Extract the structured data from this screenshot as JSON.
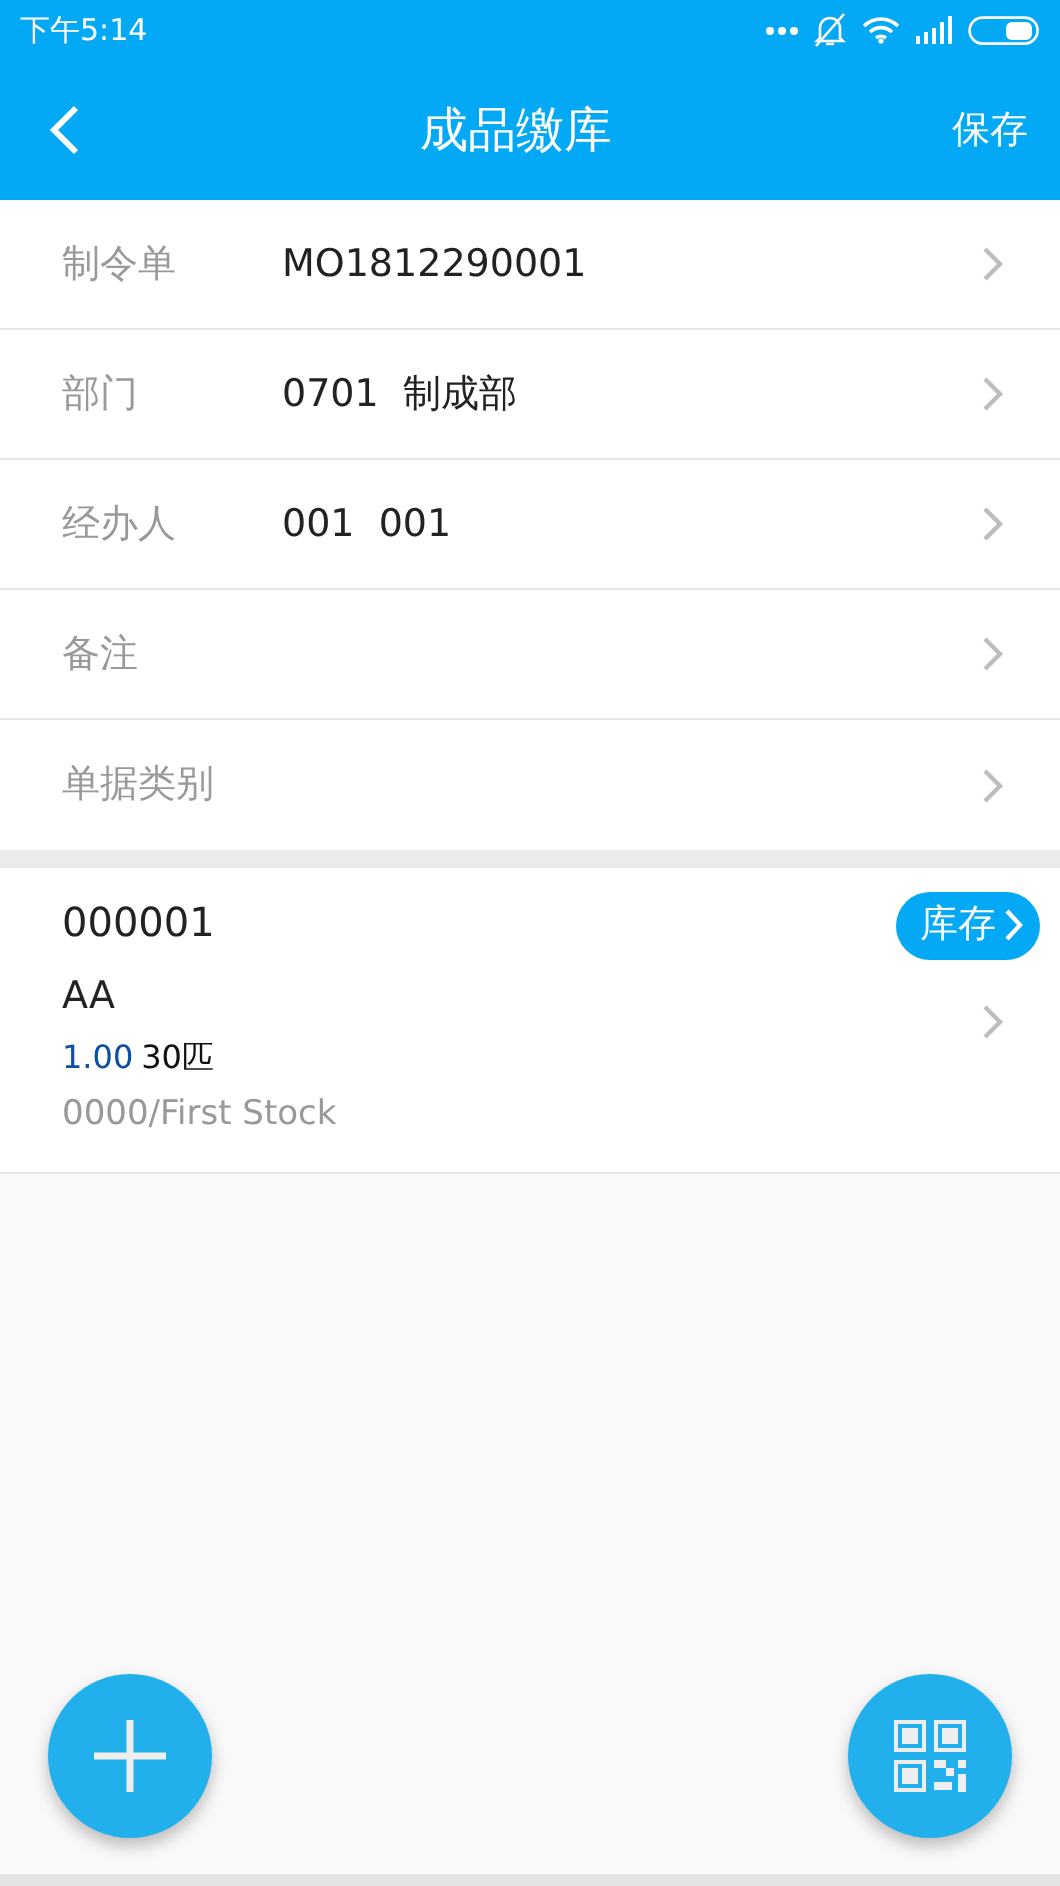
{
  "status_bar": {
    "time": "下午5:14"
  },
  "header": {
    "title": "成品缴库",
    "action": "保存"
  },
  "form_rows": [
    {
      "label": "制令单",
      "value": "MO1812290001"
    },
    {
      "label": "部门",
      "value": "0701  制成部"
    },
    {
      "label": "经办人",
      "value": "001  001"
    },
    {
      "label": "备注"
    },
    {
      "label": "单据类别"
    }
  ],
  "items": [
    {
      "code": "000001",
      "badge": "库存",
      "name": "AA",
      "quantity": "1.00",
      "unit_info": "30匹",
      "location": "0000/First Stock"
    }
  ]
}
